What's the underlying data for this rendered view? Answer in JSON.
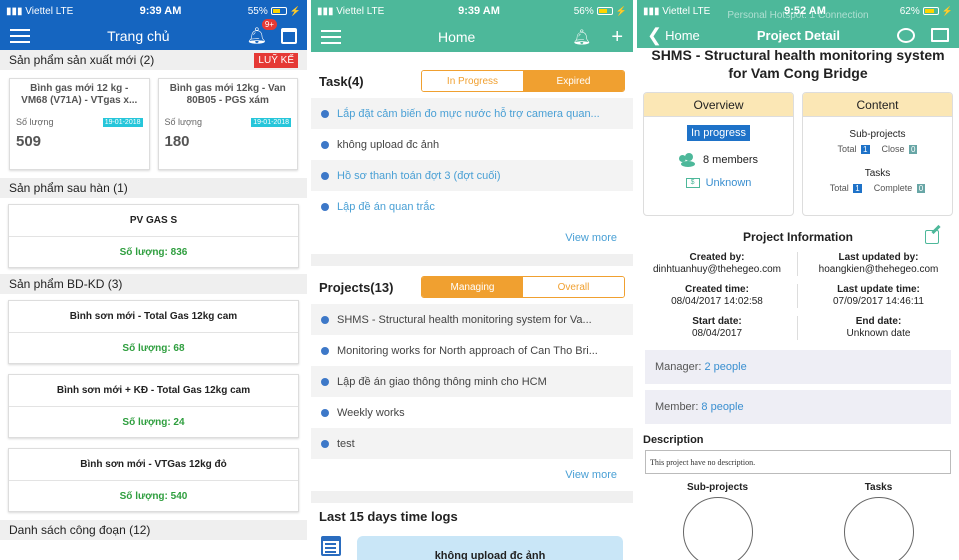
{
  "s1": {
    "status": {
      "carrier": "Viettel",
      "network": "LTE",
      "time": "9:39 AM",
      "battery": "55%"
    },
    "nav": {
      "title": "Trang chủ",
      "badge": "9+"
    },
    "new_products": {
      "title": "Sản phẩm sản xuất mới (2)",
      "luyke": "LUỸ KẾ",
      "items": [
        {
          "name": "Bình gas mới 12 kg - VM68 (V71A) - VTgas x...",
          "qty_label": "Số lượng",
          "date": "19-01-2018",
          "qty": "509"
        },
        {
          "name": "Bình gas mới 12kg - Van 80B05 - PGS xám",
          "qty_label": "Số lượng",
          "date": "19-01-2018",
          "qty": "180"
        }
      ]
    },
    "after_weld": {
      "title": "Sản phẩm sau hàn (1)",
      "items": [
        {
          "name": "PV GAS S",
          "qty": "Số lượng: 836"
        }
      ]
    },
    "bdkd": {
      "title": "Sản phẩm BD-KD (3)",
      "items": [
        {
          "name": "Bình sơn mới - Total Gas 12kg cam",
          "qty": "Số lượng: 68"
        },
        {
          "name": "Bình sơn mới + KĐ - Total Gas 12kg cam",
          "qty": "Số lượng: 24"
        },
        {
          "name": "Bình sơn mới - VTGas 12kg đỏ",
          "qty": "Số lượng: 540"
        }
      ]
    },
    "stages": {
      "title": "Danh sách công đoạn (12)"
    }
  },
  "s2": {
    "status": {
      "carrier": "Viettel",
      "network": "LTE",
      "time": "9:39 AM",
      "battery": "56%"
    },
    "nav": {
      "title": "Home"
    },
    "tasks": {
      "title": "Task(4)",
      "tab1": "In Progress",
      "tab2": "Expired",
      "items": [
        "Lắp đặt cảm biến đo mực nước hỗ trợ camera quan...",
        "không upload đc ảnh",
        "Hồ sơ thanh toán đợt 3 (đợt cuối)",
        "Lập đề án quan trắc"
      ],
      "view_more": "View more"
    },
    "projects": {
      "title": "Projects(13)",
      "tab1": "Managing",
      "tab2": "Overall",
      "items": [
        "SHMS - Structural health monitoring system for Va...",
        "Monitoring works for North approach of Can Tho Bri...",
        "Lập đề án giao thông thông minh cho HCM",
        "Weekly works",
        "test"
      ],
      "view_more": "View more"
    },
    "timelogs": {
      "title": "Last 15 days time logs",
      "first": "không upload đc ảnh"
    }
  },
  "s3": {
    "status": {
      "carrier": "Viettel",
      "network": "LTE",
      "time": "9:52 AM",
      "battery": "62%",
      "hotspot": "Personal Hotspot: 1 Connection"
    },
    "nav": {
      "back": "Home",
      "title": "Project Detail"
    },
    "title": "SHMS - Structural health monitoring system for Vam Cong Bridge",
    "overview": {
      "title": "Overview",
      "status": "In progress",
      "members": "8 members",
      "end": "Unknown"
    },
    "content": {
      "title": "Content",
      "sub_title": "Sub-projects",
      "total_label": "Total",
      "sub_total": "1",
      "close_label": "Close",
      "sub_close": "0",
      "tasks_title": "Tasks",
      "task_total": "1",
      "complete_label": "Complete",
      "task_complete": "0"
    },
    "info": {
      "title": "Project Information",
      "created_by_l": "Created by:",
      "created_by": "dinhtuanhuy@thehegeo.com",
      "updated_by_l": "Last updated by:",
      "updated_by": "hoangkien@thehegeo.com",
      "created_time_l": "Created time:",
      "created_time": "08/04/2017 14:02:58",
      "updated_time_l": "Last update time:",
      "updated_time": "07/09/2017 14:46:11",
      "start_l": "Start date:",
      "start": "08/04/2017",
      "end_l": "End date:",
      "end": "Unknown date"
    },
    "manager": {
      "label": "Manager:",
      "value": "2 people"
    },
    "member": {
      "label": "Member:",
      "value": "8 people"
    },
    "description": {
      "title": "Description",
      "text": "This project have no description."
    },
    "bottom": {
      "sub": "Sub-projects",
      "tasks": "Tasks"
    }
  }
}
